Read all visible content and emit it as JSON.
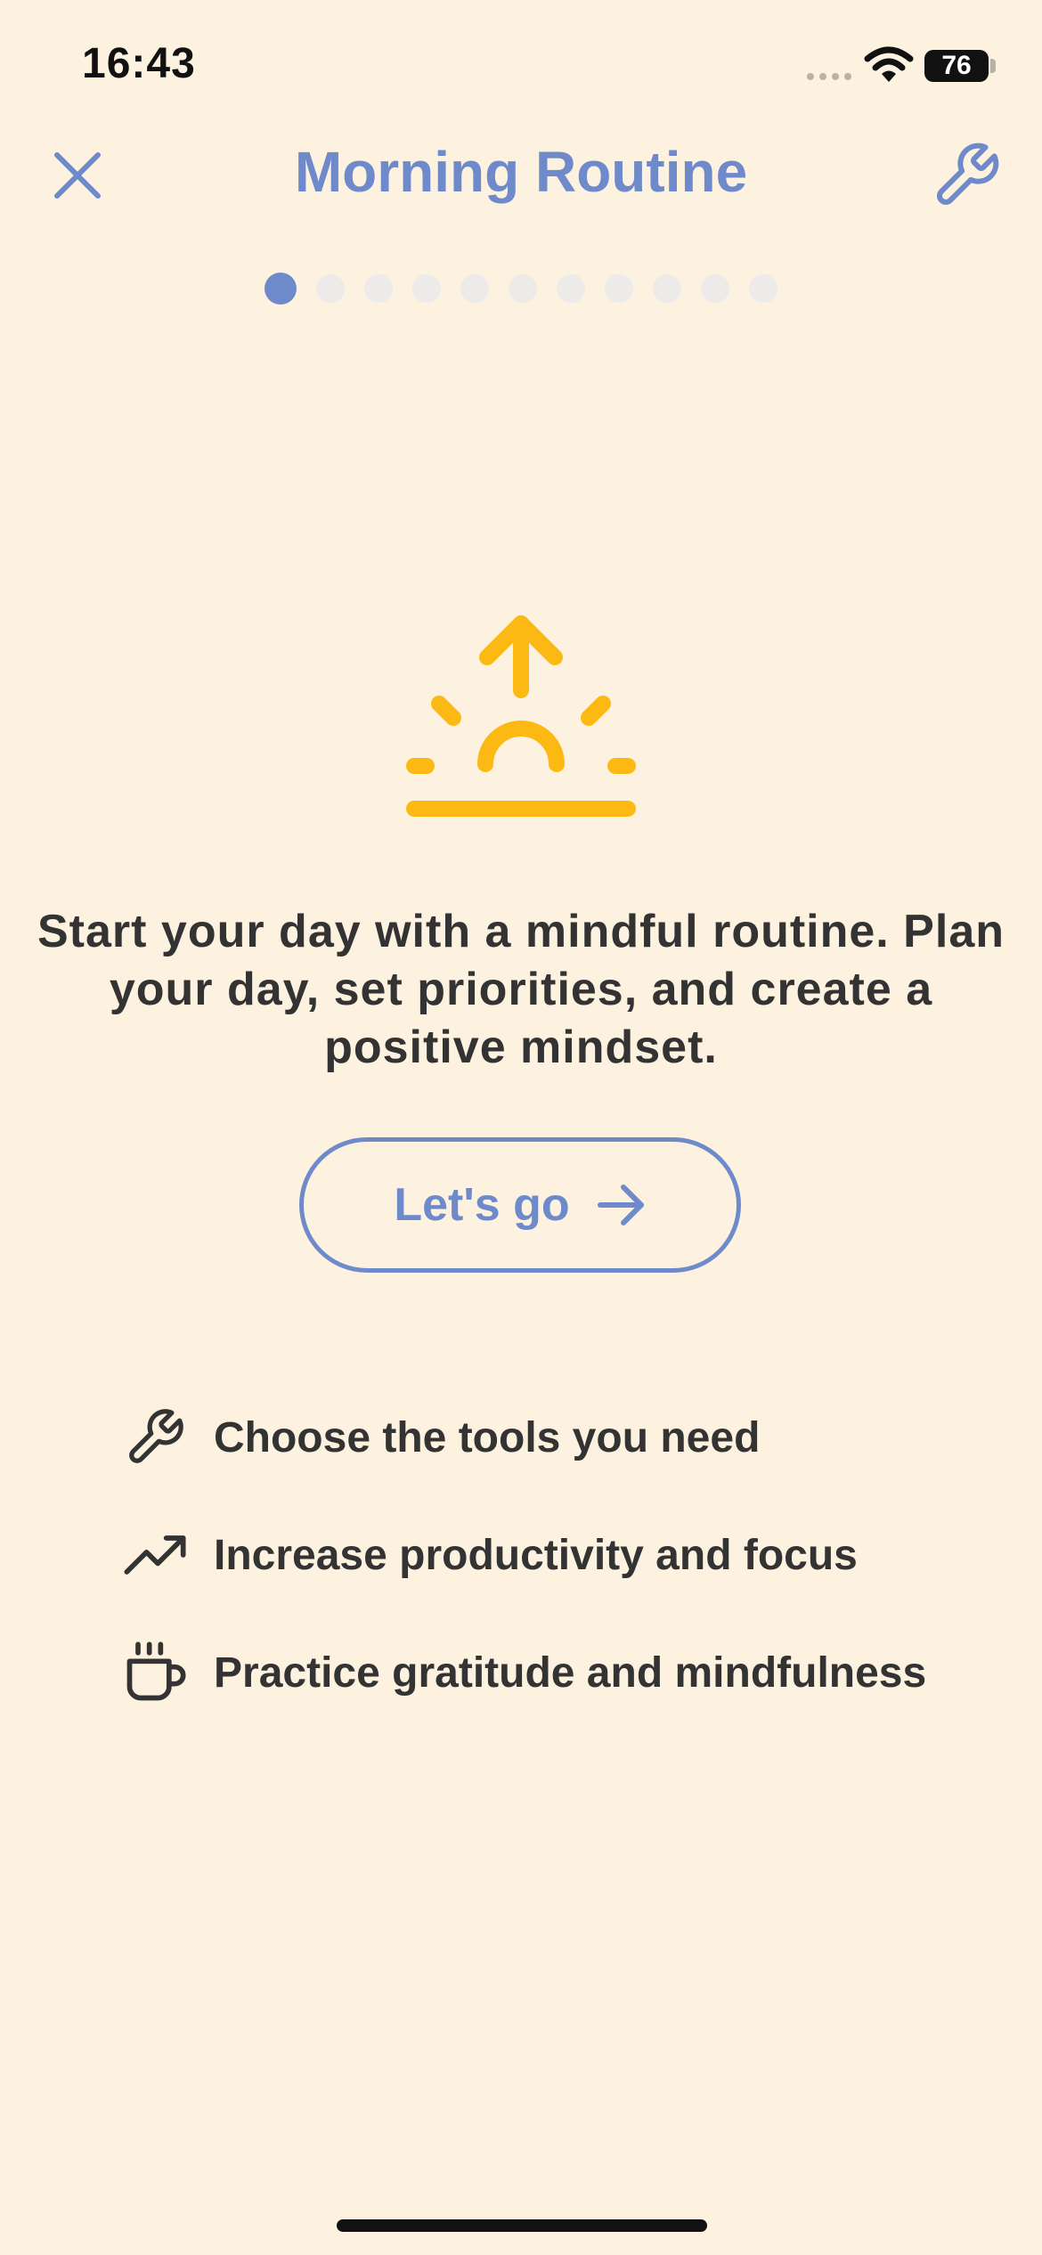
{
  "status_bar": {
    "time": "16:43",
    "battery": "76"
  },
  "header": {
    "title": "Morning Routine",
    "close_icon": "close-icon",
    "tools_icon": "wrench-icon"
  },
  "pager": {
    "total_steps": 11,
    "current_step": 1
  },
  "intro": {
    "icon": "sunrise-icon",
    "text": "Start your day with a mindful routine. Plan your day, set priorities, and create a positive mindset."
  },
  "cta": {
    "label": "Let's go",
    "icon": "arrow-right-icon"
  },
  "features": [
    {
      "icon": "wrench-icon",
      "label": "Choose the tools you need"
    },
    {
      "icon": "trending-up-icon",
      "label": "Increase productivity and focus"
    },
    {
      "icon": "coffee-cup-icon",
      "label": "Practice gratitude and mindfulness"
    }
  ],
  "colors": {
    "background": "#FDF2E0",
    "accent": "#6F8ACB",
    "sun": "#FDB913",
    "text": "#333333",
    "dot_inactive": "#ECEBEA"
  }
}
